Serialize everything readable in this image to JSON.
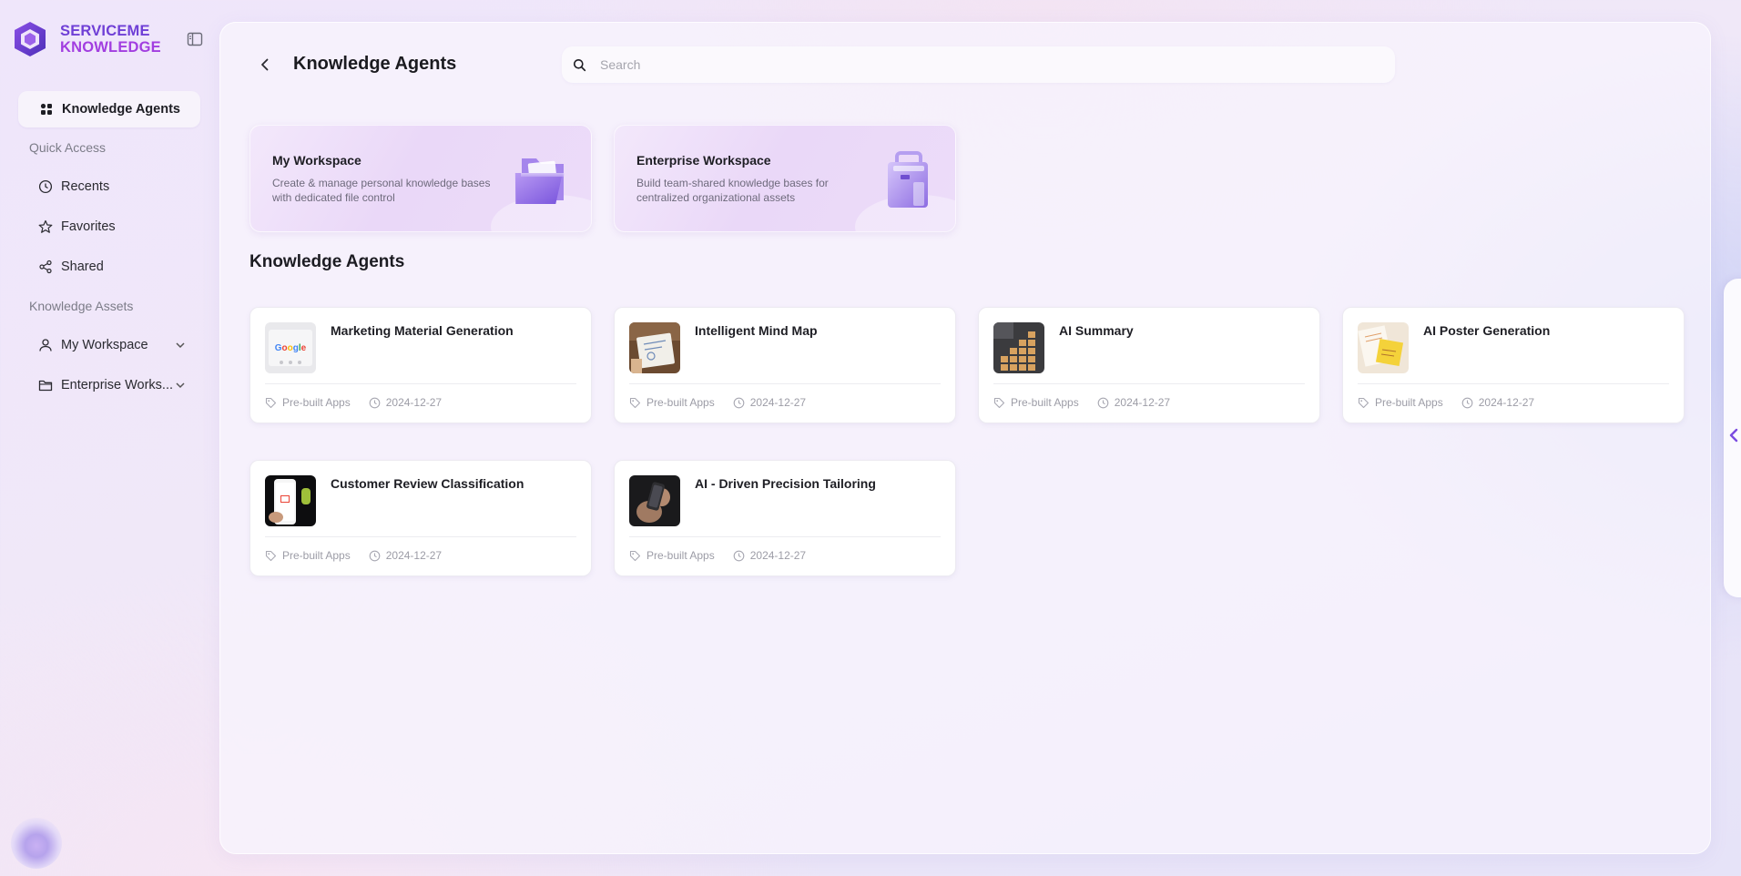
{
  "brand": {
    "line1": "SERVICEME",
    "line2": "KNOWLEDGE"
  },
  "sidebar": {
    "active_item": "Knowledge Agents",
    "quick_access_label": "Quick Access",
    "quick_access": [
      {
        "label": "Recents",
        "icon": "clock-icon"
      },
      {
        "label": "Favorites",
        "icon": "star-icon"
      },
      {
        "label": "Shared",
        "icon": "share-icon"
      }
    ],
    "assets_label": "Knowledge Assets",
    "assets": [
      {
        "label": "My Workspace",
        "icon": "user-icon"
      },
      {
        "label": "Enterprise Works...",
        "icon": "folder-icon"
      }
    ]
  },
  "header": {
    "title": "Knowledge Agents",
    "search_placeholder": "Search"
  },
  "workspaces": [
    {
      "title": "My Workspace",
      "description": "Create & manage personal knowledge bases with dedicated file control"
    },
    {
      "title": "Enterprise Workspace",
      "description": "Build team-shared knowledge bases for centralized organizational assets"
    }
  ],
  "section_title": "Knowledge Agents",
  "agents": [
    {
      "name": "Marketing Material Generation",
      "tag": "Pre-built Apps",
      "date": "2024-12-27"
    },
    {
      "name": "Intelligent Mind Map",
      "tag": "Pre-built Apps",
      "date": "2024-12-27"
    },
    {
      "name": "AI Summary",
      "tag": "Pre-built Apps",
      "date": "2024-12-27"
    },
    {
      "name": "AI Poster Generation",
      "tag": "Pre-built Apps",
      "date": "2024-12-27"
    },
    {
      "name": "Customer Review Classification",
      "tag": "Pre-built Apps",
      "date": "2024-12-27"
    },
    {
      "name": "AI - Driven Precision Tailoring",
      "tag": "Pre-built Apps",
      "date": "2024-12-27"
    }
  ],
  "colors": {
    "brand_primary": "#6f3fd6",
    "brand_secondary": "#a23ee0",
    "accent_purple": "#7b4ce0"
  }
}
